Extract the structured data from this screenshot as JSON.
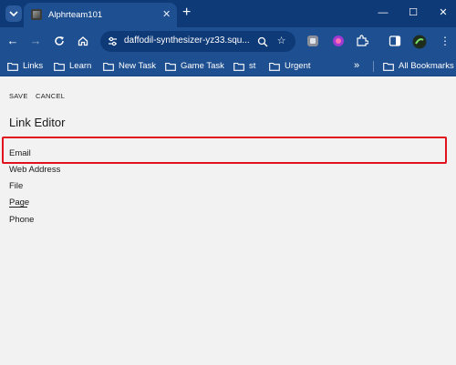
{
  "browser": {
    "tab": {
      "title": "Alphrteam101"
    },
    "address_bar": {
      "url": "daffodil-synthesizer-yz33.squ..."
    },
    "bookmarks": [
      {
        "label": "Links"
      },
      {
        "label": "Learn"
      },
      {
        "label": "New Task"
      },
      {
        "label": "Game Task"
      },
      {
        "label": "st"
      },
      {
        "label": "Urgent"
      }
    ],
    "all_bookmarks_label": "All Bookmarks",
    "accent_color": "#1e4f91"
  },
  "page": {
    "actions": {
      "save_label": "SAVE",
      "cancel_label": "CANCEL"
    },
    "title": "Link Editor",
    "options": [
      {
        "label": "Email"
      },
      {
        "label": "Web Address"
      },
      {
        "label": "File"
      },
      {
        "label": "Page"
      },
      {
        "label": "Phone"
      }
    ],
    "highlight_color": "#e0121c"
  }
}
